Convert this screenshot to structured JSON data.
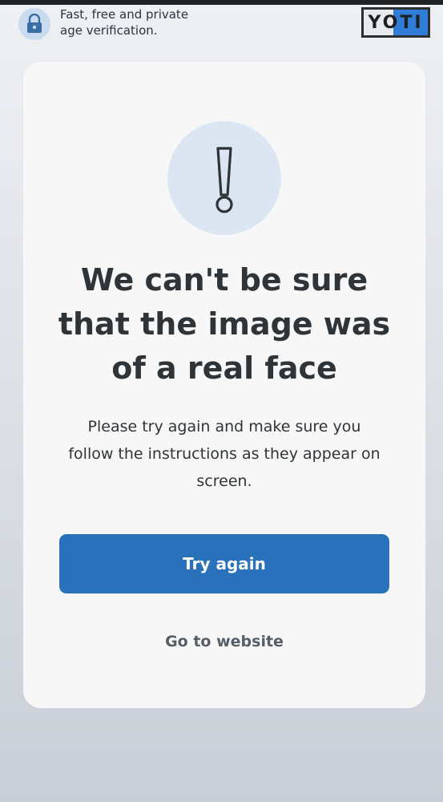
{
  "header": {
    "tagline_line1": "Fast, free and private",
    "tagline_line2": "age verification.",
    "lock_icon": "lock-icon",
    "logo_text": "YOTI",
    "logo_colors": {
      "left": "#e8eaec",
      "right": "#2f7dd6",
      "border": "#2b2f33"
    }
  },
  "card": {
    "alert_icon": "exclamation-icon",
    "title_lines": [
      "We can't be sure",
      "that the image was",
      "of a real face"
    ],
    "message_lines": [
      "Please try again and make sure you",
      "follow the instructions as they appear on",
      "screen."
    ],
    "primary_button_label": "Try again",
    "secondary_link_label": "Go to website"
  },
  "colors": {
    "accent": "#2a71bc",
    "text": "#2f3438",
    "alert_circle": "#dbe6f2"
  }
}
